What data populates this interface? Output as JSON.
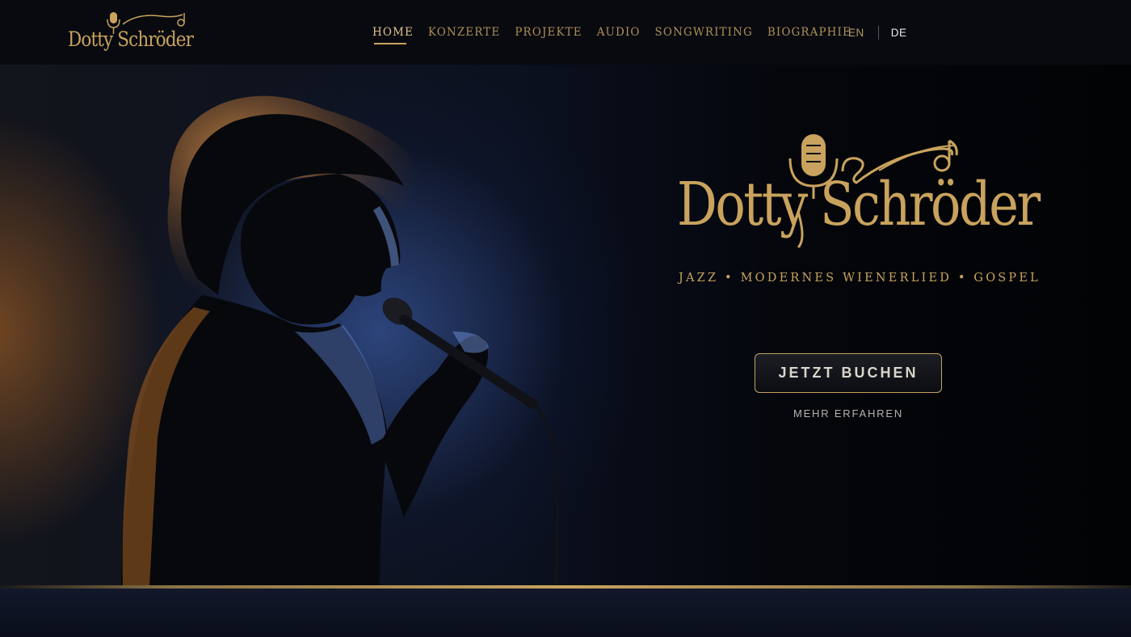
{
  "brand": {
    "name": "Dotty Schröder",
    "tagline": "JAZZ • MODERNES WIENERLIED • GOSPEL"
  },
  "nav": {
    "items": [
      "HOME",
      "KONZERTE",
      "PROJEKTE",
      "AUDIO",
      "SONGWRITING",
      "BIOGRAPHIE"
    ],
    "active": "HOME"
  },
  "languages": {
    "en": "EN",
    "de": "DE",
    "current": "DE"
  },
  "hero": {
    "cta_label": "JETZT BUCHEN",
    "secondary_label": "MEHR ERFAHREN"
  },
  "colors": {
    "gold": "#c9a35d",
    "background": "#080a10",
    "footer": "#12182a"
  },
  "icons": [
    "microphone-icon",
    "music-note-icon"
  ]
}
